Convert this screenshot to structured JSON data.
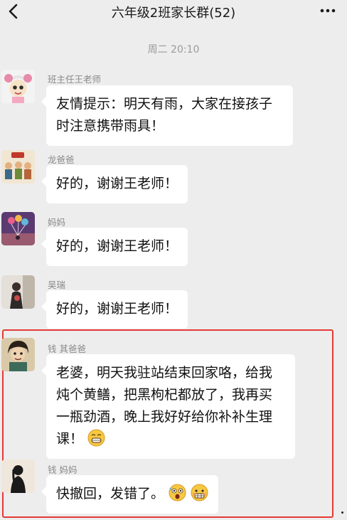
{
  "header": {
    "title": "六年级2班家长群(52)",
    "back_icon": "chevron-left-icon",
    "more_icon": "more-dots-icon"
  },
  "timestamp": "周二 20:10",
  "messages": [
    {
      "sender": "班主任王老师",
      "text": "友情提示：明天有雨，大家在接孩子时注意携带雨具！",
      "avatar_icon": "cartoon-girl-avatar"
    },
    {
      "sender": "龙爸爸",
      "text": "好的，谢谢王老师！",
      "avatar_icon": "illustration-avatar"
    },
    {
      "sender": "妈妈",
      "text": "好的，谢谢王老师！",
      "avatar_icon": "balloons-avatar"
    },
    {
      "sender": "吴瑞",
      "text": "好的，谢谢王老师！",
      "avatar_icon": "person-photo-avatar"
    },
    {
      "sender": "钱 其爸爸",
      "text": "老婆，明天我驻站结束回家咯，给我炖个黄鳝，把黑枸杞都放了，我再买一瓶劲酒，晚上我好好给你补补生理课！",
      "avatar_icon": "cartoon-man-avatar",
      "emoji": "embarrassed-grin-emoji"
    },
    {
      "sender": "钱 妈妈",
      "text": "快撤回，发错了。",
      "avatar_icon": "silhouette-woman-avatar",
      "emojis": [
        "shocked-face-emoji",
        "grimace-face-emoji"
      ]
    }
  ],
  "colors": {
    "background": "#ededed",
    "bubble": "#ffffff",
    "highlight_border": "#e53935",
    "name_text": "#8a8a8a"
  }
}
